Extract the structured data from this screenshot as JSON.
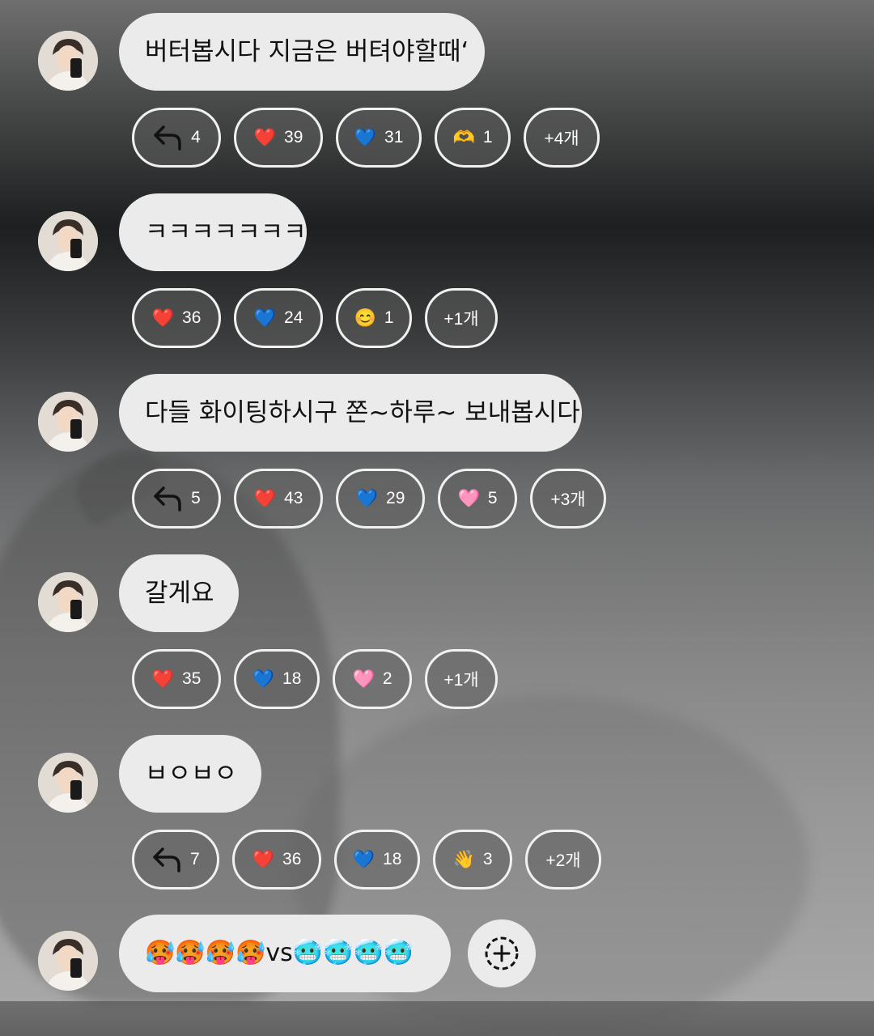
{
  "messages": [
    {
      "text": "버터봅시다 지금은 버텨야할때‘",
      "reactions": [
        {
          "type": "reply",
          "count": "4"
        },
        {
          "emoji": "❤️",
          "count": "39"
        },
        {
          "emoji": "💙",
          "count": "31"
        },
        {
          "emoji": "🫶",
          "count": "1"
        },
        {
          "more": "+4개"
        }
      ]
    },
    {
      "text": "ㅋㅋㅋㅋㅋㅋㅋ",
      "reactions": [
        {
          "emoji": "❤️",
          "count": "36"
        },
        {
          "emoji": "💙",
          "count": "24"
        },
        {
          "emoji": "😊",
          "count": "1"
        },
        {
          "more": "+1개"
        }
      ]
    },
    {
      "text": "다들 화이팅하시구 쫀~하루~ 보내봅시다",
      "reactions": [
        {
          "type": "reply",
          "count": "5"
        },
        {
          "emoji": "❤️",
          "count": "43"
        },
        {
          "emoji": "💙",
          "count": "29"
        },
        {
          "emoji": "🩷",
          "count": "5"
        },
        {
          "more": "+3개"
        }
      ]
    },
    {
      "text": "갈게요",
      "reactions": [
        {
          "emoji": "❤️",
          "count": "35"
        },
        {
          "emoji": "💙",
          "count": "18"
        },
        {
          "emoji": "🩷",
          "count": "2"
        },
        {
          "more": "+1개"
        }
      ]
    },
    {
      "text": "ㅂㅇㅂㅇ",
      "reactions": [
        {
          "type": "reply",
          "count": "7"
        },
        {
          "emoji": "❤️",
          "count": "36"
        },
        {
          "emoji": "💙",
          "count": "18"
        },
        {
          "emoji": "👋",
          "count": "3"
        },
        {
          "more": "+2개"
        }
      ]
    },
    {
      "text": "🥵🥵🥵🥵vs🥶🥶🥶🥶",
      "reactions": []
    }
  ],
  "icons": {
    "reply": "reply-arrow-icon",
    "add_reaction": "add-reaction-icon",
    "avatar": "user-avatar"
  },
  "colors": {
    "bubble_bg": "#ebebeb",
    "chip_border": "#f1f1f1"
  }
}
